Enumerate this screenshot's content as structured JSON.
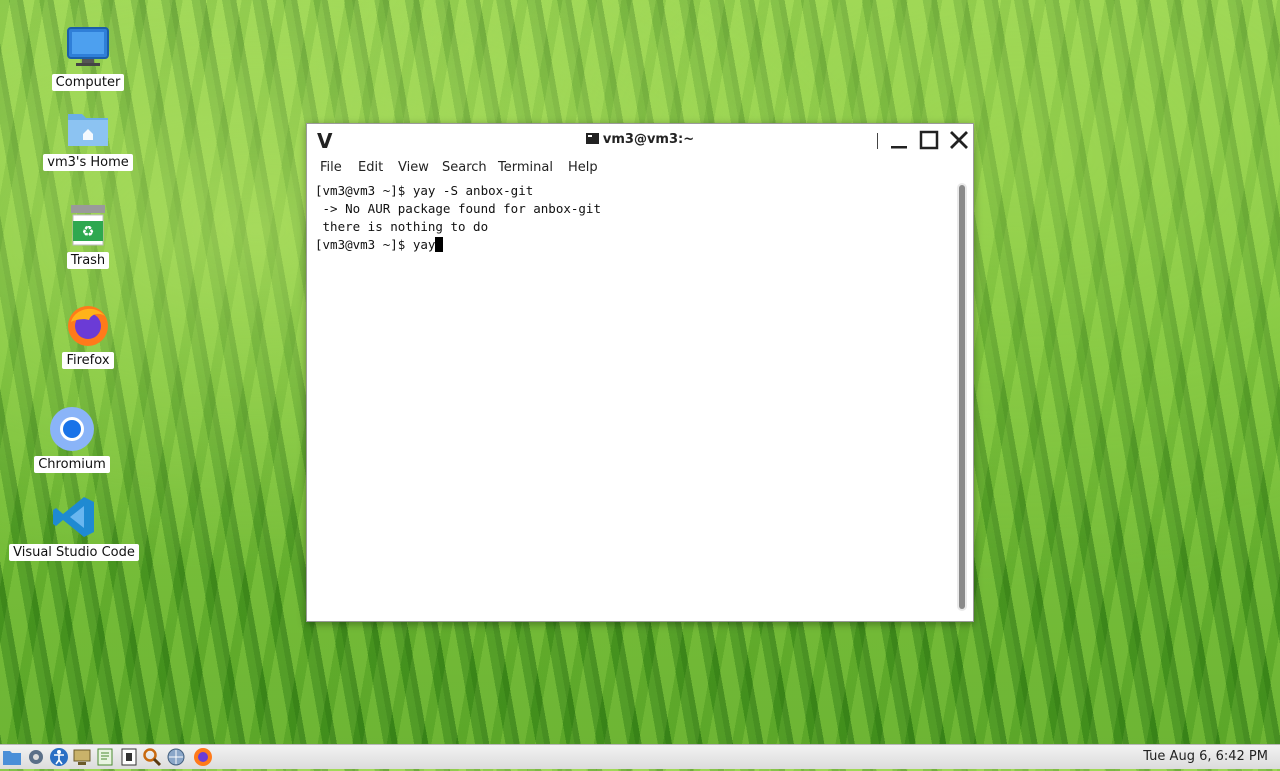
{
  "desktop": {
    "icons": [
      {
        "label": "Computer"
      },
      {
        "label": "vm3's Home"
      },
      {
        "label": "Trash"
      },
      {
        "label": "Firefox"
      },
      {
        "label": "Chromium"
      },
      {
        "label": "Visual Studio Code"
      }
    ]
  },
  "window": {
    "title": "vm3@vm3:~",
    "menu": [
      "File",
      "Edit",
      "View",
      "Search",
      "Terminal",
      "Help"
    ],
    "terminal_lines": [
      "[vm3@vm3 ~]$ yay -S anbox-git",
      " -> No AUR package found for anbox-git",
      " there is nothing to do",
      "[vm3@vm3 ~]$ yay"
    ]
  },
  "taskbar": {
    "clock": "Tue Aug  6,  6:42 PM"
  },
  "colors": {
    "window_bg": "#ffffff",
    "taskbar_bg": "#e6e6e6"
  }
}
